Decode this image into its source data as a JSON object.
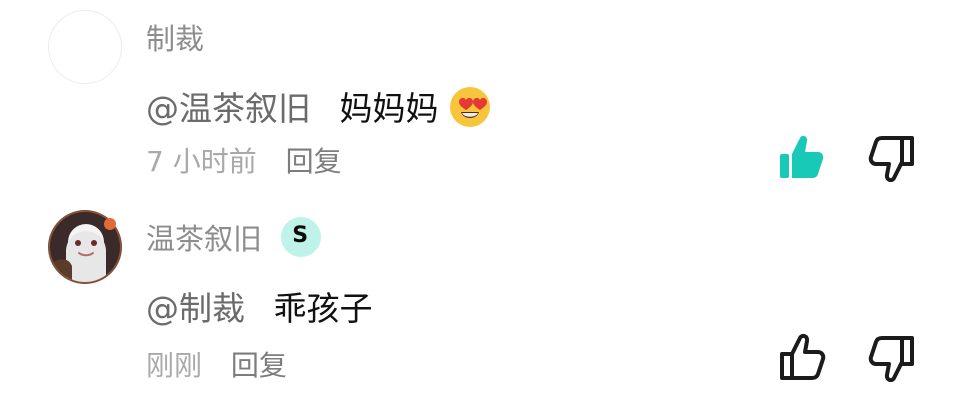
{
  "comments": [
    {
      "username": "制裁",
      "mention": "@温茶叙旧",
      "content": "妈妈妈",
      "emoji": "heart-eyes-emoji",
      "time": "7 小时前",
      "reply_label": "回复",
      "liked": true
    },
    {
      "username": "温茶叙旧",
      "mention": "@制裁",
      "content": "乖孩子",
      "time": "刚刚",
      "reply_label": "回复",
      "liked": false
    }
  ],
  "colors": {
    "accent_like": "#19c9b8",
    "text_primary": "#111111",
    "text_secondary": "#8d8d8d",
    "meta": "#a9a9a9"
  }
}
